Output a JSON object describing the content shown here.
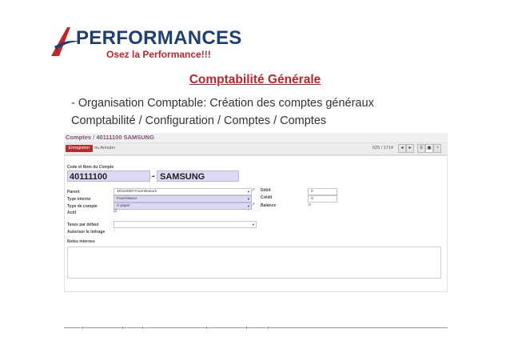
{
  "logo": {
    "brand": "PERFORMANCES",
    "tagline": "Osez la Performance!!!"
  },
  "slide": {
    "title": "Comptabilité Générale",
    "line1": "- Organisation Comptable: Création des comptes généraux",
    "line2": "Comptabilité / Configuration / Comptes / Comptes"
  },
  "app": {
    "breadcrumb": {
      "parent": "Comptes",
      "separator": "/",
      "current": "40111100 SAMSUNG"
    },
    "toolbar": {
      "save_label": "Enregistrer",
      "cancel_label": "ou Annuler",
      "pager": "625 / 1714"
    },
    "form": {
      "code_name_label": "Code et Nom du Compte",
      "code": "40111100",
      "dash": "-",
      "name": "SAMSUNG",
      "parent_label": "Parent",
      "parent_value": "40110000 Fournisseurs",
      "internal_type_label": "Type interne",
      "internal_type_value": "Fournisseur",
      "account_type_label": "Type de compte",
      "account_type_value": "À payer",
      "active_label": "Actif",
      "debit_label": "Débit",
      "debit_value": "0",
      "credit_label": "Crédit",
      "credit_value": "0",
      "balance_label": "Balance",
      "balance_value": "0",
      "taxes_label": "Taxes par défaut",
      "lettrage_label": "Autoriser le lettrage",
      "notes_label": "Notes internes"
    }
  }
}
